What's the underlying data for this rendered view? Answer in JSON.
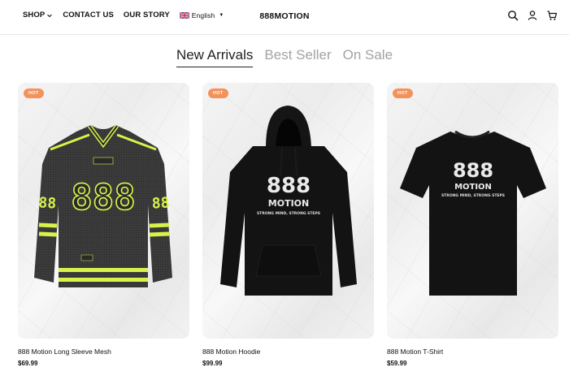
{
  "header": {
    "nav": [
      {
        "label": "SHOP",
        "has_dropdown": true
      },
      {
        "label": "CONTACT US"
      },
      {
        "label": "OUR STORY"
      }
    ],
    "language": {
      "label": "English",
      "flag": "uk-flag-icon"
    },
    "logo": "888MOTION",
    "icons": [
      "search-icon",
      "account-icon",
      "cart-icon"
    ]
  },
  "tabs": [
    {
      "label": "New Arrivals",
      "active": true
    },
    {
      "label": "Best Seller",
      "active": false
    },
    {
      "label": "On Sale",
      "active": false
    }
  ],
  "products": [
    {
      "name": "888 Motion Long Sleeve Mesh",
      "price": "$69.99",
      "badge": "HOT",
      "graphic": "888",
      "graphic_small": "",
      "tagline": ""
    },
    {
      "name": "888 Motion Hoodie",
      "price": "$99.99",
      "badge": "HOT",
      "graphic": "888",
      "graphic_small": "MOTION",
      "tagline": "STRONG MIND, STRONG STEPS"
    },
    {
      "name": "888 Motion T-Shirt",
      "price": "$59.99",
      "badge": "HOT",
      "graphic": "888",
      "graphic_small": "MOTION",
      "tagline": "STRONG MIND, STRONG STEPS"
    }
  ],
  "colors": {
    "badge": "#f3925a",
    "accent_neon": "#d9f24a",
    "jersey": "#3a3a3a",
    "garment_black": "#121212"
  }
}
